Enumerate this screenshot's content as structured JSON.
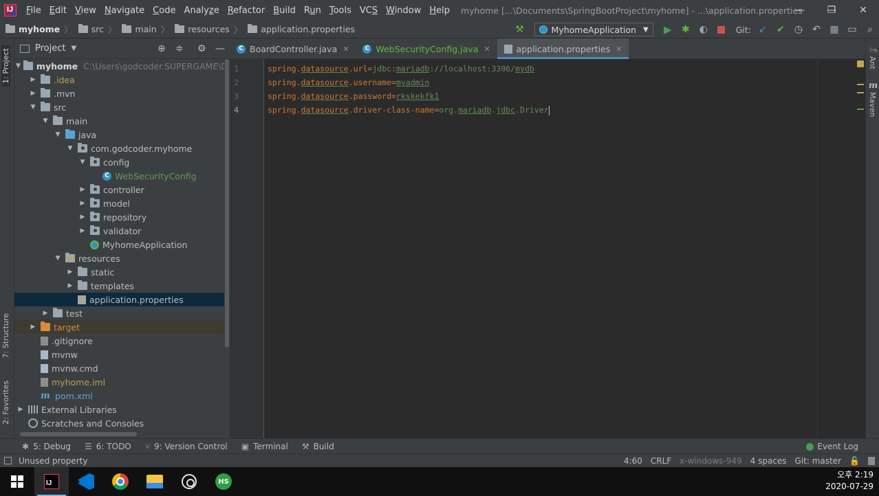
{
  "window": {
    "title": "myhome [...\\Documents\\SpringBootProject\\myhome] - ...\\application.properties",
    "minimize": "—",
    "restore": "❐",
    "close": "✕"
  },
  "menu": {
    "items": [
      {
        "label": "File",
        "key": "F"
      },
      {
        "label": "Edit",
        "key": "E"
      },
      {
        "label": "View",
        "key": "V"
      },
      {
        "label": "Navigate",
        "key": "N"
      },
      {
        "label": "Code",
        "key": "C"
      },
      {
        "label": "Analyze",
        "key": "z"
      },
      {
        "label": "Refactor",
        "key": "R"
      },
      {
        "label": "Build",
        "key": "B"
      },
      {
        "label": "Run",
        "key": "u"
      },
      {
        "label": "Tools",
        "key": "T"
      },
      {
        "label": "VCS",
        "key": "S"
      },
      {
        "label": "Window",
        "key": "W"
      },
      {
        "label": "Help",
        "key": "H"
      }
    ]
  },
  "breadcrumb": {
    "items": [
      "myhome",
      "src",
      "main",
      "resources",
      "application.properties"
    ]
  },
  "toolbar": {
    "run_config": "MyhomeApplication",
    "git_label": "Git:"
  },
  "project_panel": {
    "title": "Project",
    "tree": [
      {
        "label": "myhome",
        "path": "C:\\Users\\godcoder.SUPERGAME\\Doc",
        "depth": 0,
        "arrow": "down",
        "icon": "folder",
        "style": "bold"
      },
      {
        "label": ".idea",
        "depth": 1,
        "arrow": "right",
        "icon": "folder",
        "style": "gold"
      },
      {
        "label": ".mvn",
        "depth": 1,
        "arrow": "right",
        "icon": "folder",
        "style": ""
      },
      {
        "label": "src",
        "depth": 1,
        "arrow": "down",
        "icon": "folder",
        "style": ""
      },
      {
        "label": "main",
        "depth": 2,
        "arrow": "down",
        "icon": "folder",
        "style": ""
      },
      {
        "label": "java",
        "depth": 3,
        "arrow": "down",
        "icon": "folder-blue",
        "style": ""
      },
      {
        "label": "com.godcoder.myhome",
        "depth": 4,
        "arrow": "down",
        "icon": "folder-pkg",
        "style": ""
      },
      {
        "label": "config",
        "depth": 5,
        "arrow": "down",
        "icon": "folder-pkg",
        "style": ""
      },
      {
        "label": "WebSecurityConfig",
        "depth": 6,
        "arrow": "none",
        "icon": "class-c",
        "style": "green"
      },
      {
        "label": "controller",
        "depth": 5,
        "arrow": "right",
        "icon": "folder-pkg",
        "style": ""
      },
      {
        "label": "model",
        "depth": 5,
        "arrow": "right",
        "icon": "folder-pkg",
        "style": ""
      },
      {
        "label": "repository",
        "depth": 5,
        "arrow": "right",
        "icon": "folder-pkg",
        "style": ""
      },
      {
        "label": "validator",
        "depth": 5,
        "arrow": "right",
        "icon": "folder-pkg",
        "style": ""
      },
      {
        "label": "MyhomeApplication",
        "depth": 5,
        "arrow": "none",
        "icon": "class-spring",
        "style": ""
      },
      {
        "label": "resources",
        "depth": 3,
        "arrow": "down",
        "icon": "folder-res",
        "style": ""
      },
      {
        "label": "static",
        "depth": 4,
        "arrow": "right",
        "icon": "folder",
        "style": ""
      },
      {
        "label": "templates",
        "depth": 4,
        "arrow": "right",
        "icon": "folder",
        "style": ""
      },
      {
        "label": "application.properties",
        "depth": 4,
        "arrow": "none",
        "icon": "file-props",
        "style": "",
        "selected": true
      },
      {
        "label": "test",
        "depth": 2,
        "arrow": "right",
        "icon": "folder",
        "style": ""
      },
      {
        "label": "target",
        "depth": 1,
        "arrow": "right",
        "icon": "folder-orange",
        "style": "orange",
        "excluded": true
      },
      {
        "label": ".gitignore",
        "depth": 1,
        "arrow": "none",
        "icon": "file-gray",
        "style": ""
      },
      {
        "label": "mvnw",
        "depth": 1,
        "arrow": "none",
        "icon": "file",
        "style": ""
      },
      {
        "label": "mvnw.cmd",
        "depth": 1,
        "arrow": "none",
        "icon": "file",
        "style": ""
      },
      {
        "label": "myhome.iml",
        "depth": 1,
        "arrow": "none",
        "icon": "file-iml",
        "style": "gold"
      },
      {
        "label": "pom.xml",
        "depth": 1,
        "arrow": "none",
        "icon": "maven-m",
        "style": "blue"
      },
      {
        "label": "External Libraries",
        "depth": 0,
        "arrow": "right",
        "icon": "libs",
        "style": ""
      },
      {
        "label": "Scratches and Consoles",
        "depth": 0,
        "arrow": "none",
        "icon": "scratch",
        "style": ""
      }
    ]
  },
  "left_stripe": {
    "project": "1: Project",
    "structure": "7: Structure",
    "favorites": "2: Favorites"
  },
  "right_stripe": {
    "ant": "Ant",
    "maven": "Maven"
  },
  "editor": {
    "tabs": [
      {
        "label": "BoardController.java",
        "icon": "C",
        "active": false,
        "style": ""
      },
      {
        "label": "WebSecurityConfig.java",
        "icon": "C",
        "active": false,
        "style": "green"
      },
      {
        "label": "application.properties",
        "icon": "props",
        "active": true,
        "style": ""
      }
    ],
    "lines": [
      {
        "num": "1",
        "segments": [
          [
            "k",
            "spring."
          ],
          [
            "u",
            "datasource"
          ],
          [
            "k",
            ".url"
          ],
          [
            "eq",
            "="
          ],
          [
            "v",
            "jdbc"
          ],
          [
            "k",
            ":"
          ],
          [
            "vu",
            "mariadb"
          ],
          [
            "v",
            "://localhost:3306/"
          ],
          [
            "vu",
            "mydb"
          ]
        ]
      },
      {
        "num": "2",
        "segments": [
          [
            "k",
            "spring."
          ],
          [
            "u",
            "datasource"
          ],
          [
            "k",
            ".username"
          ],
          [
            "eq",
            "="
          ],
          [
            "vu",
            "myadmin"
          ]
        ]
      },
      {
        "num": "3",
        "segments": [
          [
            "k",
            "spring."
          ],
          [
            "u",
            "datasource"
          ],
          [
            "k",
            ".password"
          ],
          [
            "eq",
            "="
          ],
          [
            "vu",
            "rkskekfk1"
          ]
        ]
      },
      {
        "num": "4",
        "segments": [
          [
            "k",
            "spring."
          ],
          [
            "u",
            "datasource"
          ],
          [
            "k",
            ".driver-class-name"
          ],
          [
            "eq",
            "="
          ],
          [
            "v",
            "org."
          ],
          [
            "vu",
            "mariadb"
          ],
          [
            "v",
            "."
          ],
          [
            "vu",
            "jdbc"
          ],
          [
            "v",
            ".Driver"
          ]
        ]
      }
    ]
  },
  "tool_windows": {
    "debug": "5: Debug",
    "todo": "6: TODO",
    "vcs": "9: Version Control",
    "terminal": "Terminal",
    "build": "Build",
    "event_log": "Event Log"
  },
  "status": {
    "message": "Unused property",
    "position": "4:60",
    "line_sep": "CRLF",
    "encoding": "x-windows-949",
    "indent": "4 spaces",
    "branch": "Git: master"
  },
  "taskbar": {
    "time": "오후 2:19",
    "date": "2020-07-29",
    "hs_label": "HS",
    "ij_label": "IJ"
  },
  "colors": {
    "accent": "#4a88c7",
    "selection": "#0d293e",
    "keyword": "#cc7832",
    "string": "#6a8759"
  }
}
